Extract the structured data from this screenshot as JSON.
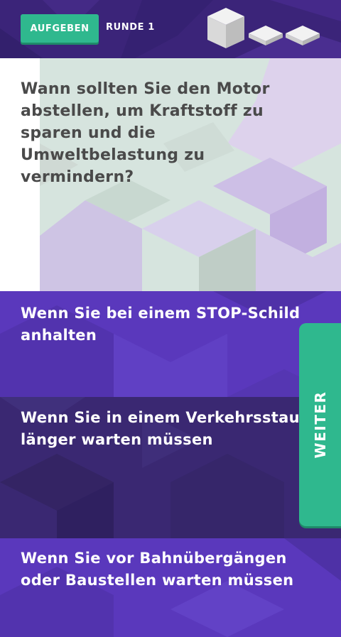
{
  "header": {
    "give_up_label": "AUFGEBEN",
    "round_label": "RUNDE 1"
  },
  "question": {
    "text": "Wann sollten Sie den Motor abstellen, um Kraftstoff zu sparen und die Umweltbelastung zu vermindern?"
  },
  "answers": [
    {
      "text": "Wenn Sie bei einem STOP-Schild anhalten"
    },
    {
      "text": "Wenn Sie in einem Verkehrsstau länger warten müssen"
    },
    {
      "text": "Wenn Sie vor Bahnübergängen oder Baustellen warten müssen"
    }
  ],
  "next_label": "WEITER",
  "colors": {
    "accent": "#2fb88e",
    "header_bg": "#3b2479",
    "answer_bg": "#5a38bc",
    "answer_selected_bg": "#3a2872",
    "question_text": "#4a4a4a"
  }
}
